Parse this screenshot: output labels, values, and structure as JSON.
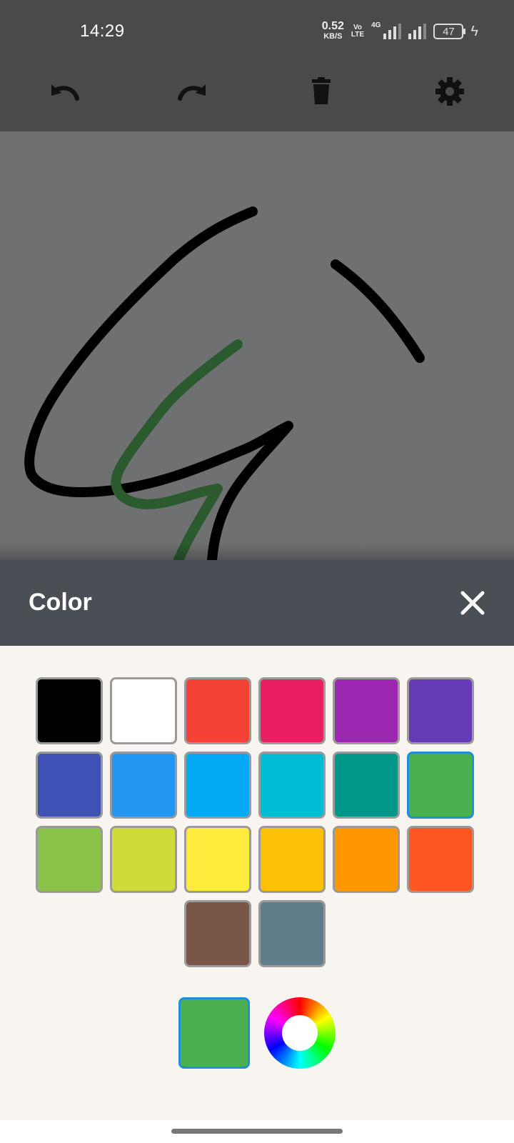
{
  "status_bar": {
    "time": "14:29",
    "speed_value": "0.52",
    "speed_unit": "KB/S",
    "volte_top": "Vo",
    "volte_bottom": "LTE",
    "network": "4G",
    "battery": "47"
  },
  "toolbar": {
    "undo_icon": "undo-icon",
    "redo_icon": "redo-icon",
    "delete_icon": "trash-icon",
    "settings_icon": "gear-icon"
  },
  "canvas": {
    "background": "#6f7072",
    "strokes": [
      {
        "color": "#000000",
        "name": "black-stroke-1"
      },
      {
        "color": "#000000",
        "name": "black-stroke-2"
      },
      {
        "color": "#2a5a2e",
        "name": "green-stroke"
      }
    ]
  },
  "color_sheet": {
    "title": "Color",
    "close_icon": "close-icon",
    "swatches": [
      "#000000",
      "#ffffff",
      "#f44336",
      "#e91e63",
      "#9c27b0",
      "#673ab7",
      "#3f51b5",
      "#2196f3",
      "#03a9f4",
      "#00bcd4",
      "#009688",
      "#4caf50",
      "#8bc34a",
      "#cddc39",
      "#ffeb3b",
      "#ffc107",
      "#ff9800",
      "#ff5722",
      "#795548",
      "#607d8b"
    ],
    "selected_color": "#4caf50",
    "wheel_icon": "color-wheel-icon"
  }
}
